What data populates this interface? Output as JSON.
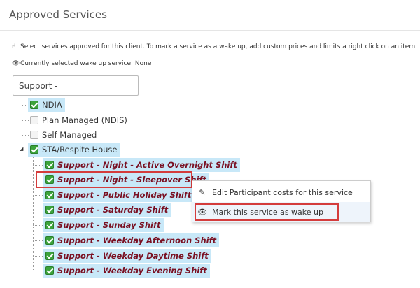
{
  "header": {
    "title": "Approved Services"
  },
  "instructions": {
    "select_icon": "pointer-hand-icon",
    "select_text": "Select services approved for this client. To mark a service as a wake up, add custom prices and limits a right click on an item",
    "wake_icon": "eye-icon",
    "wake_text": "Currently selected wake up service: None"
  },
  "search": {
    "value": "Support -"
  },
  "tree": {
    "roots": [
      {
        "label": "NDIA",
        "checked": true,
        "selected": true
      },
      {
        "label": "Plan Managed (NDIS)",
        "checked": false,
        "selected": false
      },
      {
        "label": "Self Managed",
        "checked": false,
        "selected": false
      },
      {
        "label": "STA/Respite House",
        "checked": true,
        "selected": true,
        "expanded": true
      }
    ],
    "children": [
      {
        "label": "Support - Night - Active Overnight Shift",
        "checked": true
      },
      {
        "label": "Support - Night - Sleepover Shift",
        "checked": true,
        "highlighted": true
      },
      {
        "label": "Support - Public Holiday Shift",
        "checked": true
      },
      {
        "label": "Support - Saturday Shift",
        "checked": true
      },
      {
        "label": "Support - Sunday Shift",
        "checked": true
      },
      {
        "label": "Support - Weekday Afternoon Shift",
        "checked": true
      },
      {
        "label": "Support - Weekday Daytime Shift",
        "checked": true
      },
      {
        "label": "Support - Weekday Evening Shift",
        "checked": true
      }
    ]
  },
  "context_menu": {
    "items": [
      {
        "icon": "pencil-icon",
        "label": "Edit Participant costs for this service"
      },
      {
        "icon": "eye-icon",
        "label": "Mark this service as wake up"
      }
    ]
  },
  "colors": {
    "selection": "#c8e8f8",
    "check_green": "#3ba33b",
    "child_text": "#7a1022",
    "highlight_red": "#d43c3c"
  }
}
